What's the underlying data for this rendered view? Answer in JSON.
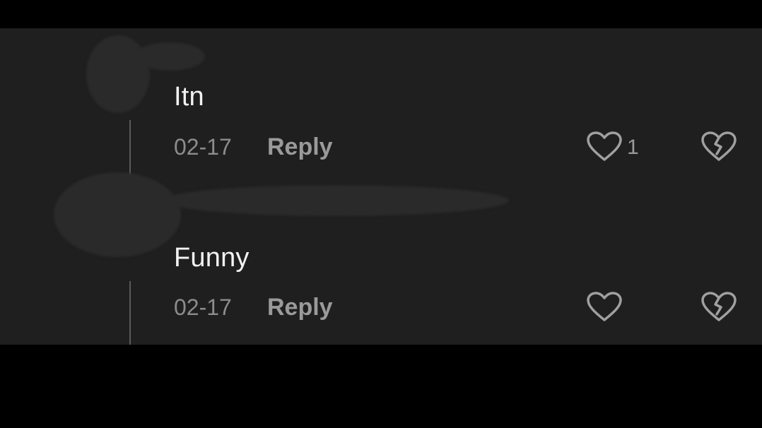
{
  "comments": [
    {
      "text": "Itn",
      "date": "02-17",
      "reply_label": "Reply",
      "like_count": "1",
      "like_icon": "heart-outline-icon",
      "dislike_icon": "broken-heart-icon"
    },
    {
      "text": "Funny",
      "date": "02-17",
      "reply_label": "Reply",
      "like_count": "",
      "like_icon": "heart-outline-icon",
      "dislike_icon": "broken-heart-icon"
    }
  ],
  "colors": {
    "background": "#000000",
    "panel": "#1f1f1f",
    "text_primary": "#f2f2f2",
    "text_secondary": "#8c8c8c",
    "icon": "#a0a0a0"
  }
}
